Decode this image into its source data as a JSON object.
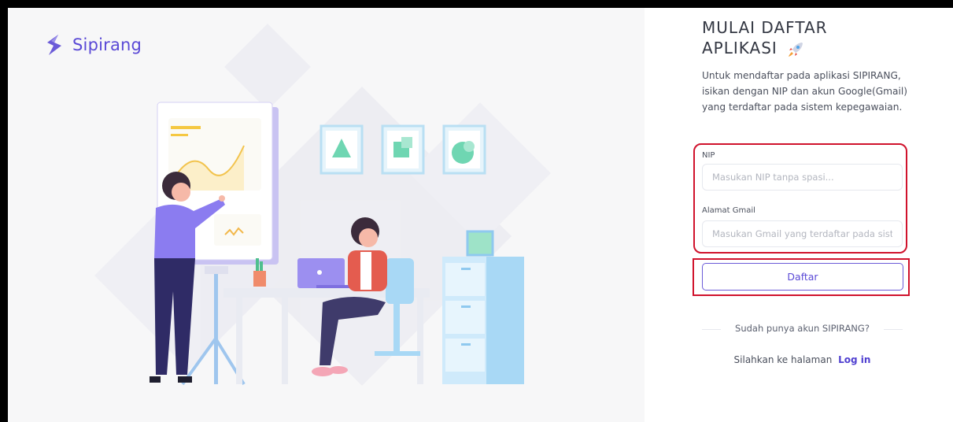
{
  "brand": {
    "name": "Sipirang",
    "icon": "sipirang-logo-icon",
    "color": "#5a49d6"
  },
  "register": {
    "title": "MULAI DAFTAR APLIKASI",
    "title_icon": "rocket-icon",
    "description": "Untuk mendaftar pada aplikasi SIPIRANG, isikan dengan NIP dan akun Google(Gmail) yang terdaftar pada sistem kepegawaian."
  },
  "form": {
    "nip_label": "NIP",
    "nip_placeholder": "Masukan NIP tanpa spasi...",
    "gmail_label": "Alamat Gmail",
    "gmail_placeholder": "Masukan Gmail yang terdaftar pada sistem kepegawaian",
    "submit_label": "Daftar"
  },
  "footer": {
    "question": "Sudah punya akun SIPIRANG?",
    "login_prefix": "Silahkan ke halaman",
    "login_link": "Log in"
  },
  "colors": {
    "accent": "#5a49d6",
    "highlight": "#d0122c",
    "border": "#000000"
  }
}
